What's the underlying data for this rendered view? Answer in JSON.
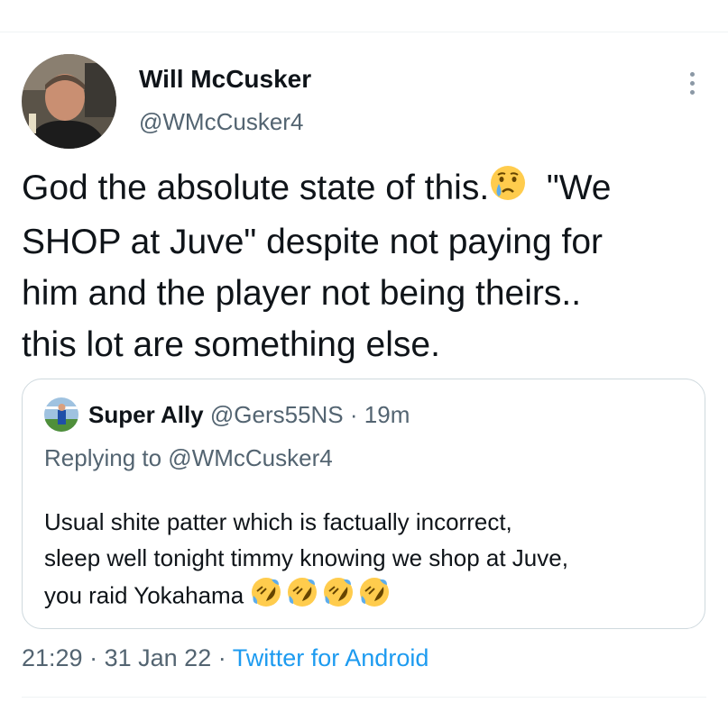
{
  "tweet": {
    "author": {
      "name": "Will McCusker",
      "handle": "@WMcCusker4"
    },
    "text_lines": [
      "God the absolute state of this.",
      "\"We",
      "SHOP at Juve\" despite not paying for",
      "him and the player not being theirs..",
      "this lot are something else."
    ],
    "text_emoji": "crying-face-emoji",
    "time": "21:29",
    "date": "31 Jan 22",
    "separator": "·",
    "source": "Twitter for Android"
  },
  "quote": {
    "author": {
      "name": "Super Ally",
      "handle": "@Gers55NS"
    },
    "separator": "·",
    "time": "19m",
    "replying_to": "Replying to @WMcCusker4",
    "text_lines": [
      "Usual shite patter which is factually incorrect,",
      "sleep well tonight timmy knowing we shop at Juve,",
      "you raid Yokahama"
    ],
    "emoji": "rolling-on-floor-laughing-emoji",
    "emoji_count": 4
  },
  "colors": {
    "text": "#0f1419",
    "secondary": "#536471",
    "link": "#1d9bf0",
    "border": "#cfd9de"
  }
}
